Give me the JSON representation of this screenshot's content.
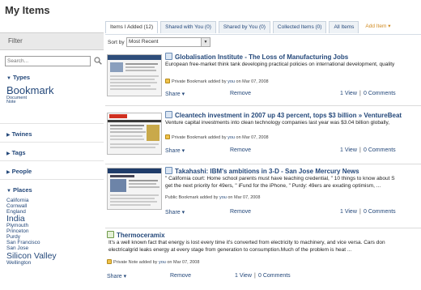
{
  "page": {
    "title": "My Items"
  },
  "tabs": [
    {
      "label": "Items I Added (12)",
      "active": true
    },
    {
      "label": "Shared with You (0)",
      "active": false
    },
    {
      "label": "Shared by You (0)",
      "active": false
    },
    {
      "label": "Collected Items (0)",
      "active": false
    },
    {
      "label": "All Items",
      "active": false
    },
    {
      "label": "Add Item ▾",
      "active": false
    }
  ],
  "sidebar": {
    "filter_label": "Filter",
    "search_placeholder": "Search...",
    "facets": {
      "types": {
        "label": "Types",
        "items": [
          {
            "label": "Bookmark",
            "size": "large"
          },
          {
            "label": "Document",
            "size": "small"
          },
          {
            "label": "Note",
            "size": "small"
          }
        ]
      },
      "twines": {
        "label": "Twines"
      },
      "tags": {
        "label": "Tags"
      },
      "people": {
        "label": "People"
      },
      "places": {
        "label": "Places",
        "items": [
          {
            "label": "California",
            "size": "small"
          },
          {
            "label": "Cornwall",
            "size": "small"
          },
          {
            "label": "England",
            "size": "small"
          },
          {
            "label": "India",
            "size": "medium"
          },
          {
            "label": "Plymouth",
            "size": "small"
          },
          {
            "label": "Princeton",
            "size": "small"
          },
          {
            "label": "Purdy",
            "size": "small"
          },
          {
            "label": "San Francisco",
            "size": "small"
          },
          {
            "label": "San Jose",
            "size": "small"
          },
          {
            "label": "Silicon Valley",
            "size": "medium"
          },
          {
            "label": "Wellington",
            "size": "small"
          }
        ]
      }
    }
  },
  "sort": {
    "label": "Sort by",
    "value": "Most Recent"
  },
  "items": [
    {
      "title": "Globalisation Institute - The Loss of Manufacturing Jobs",
      "description": "European free-market think tank developing practical policies on international development, quality",
      "meta_prefix": "Private Bookmark added by",
      "meta_user": "you",
      "meta_date": "on Mar 07, 2008",
      "share": "Share ▾",
      "remove": "Remove",
      "views": "1 View",
      "comments": "0 Comments"
    },
    {
      "title": "Cleantech investment in 2007 up 43 percent, tops $3 billion » VentureBeat",
      "description": "Venture capital investments into clean technology companies last year was $3.04 billion globally,",
      "meta_prefix": "Private Bookmark added by",
      "meta_user": "you",
      "meta_date": "on Mar 07, 2008",
      "share": "Share ▾",
      "remove": "Remove",
      "views": "1 View",
      "comments": "0 Comments"
    },
    {
      "title": "Takahashi: IBM's ambitions in 3-D - San Jose Mercury News",
      "description": "\" California court: Home school parents must have teaching credential, \" 10 things to know about S",
      "description2": "get the next priority for 49ers, \" iFund for the iPhone, \" Purdy: 49ers are exuding optimism, ...",
      "meta_prefix": "Public Bookmark added by",
      "meta_user": "you",
      "meta_date": "on Mar 07, 2008",
      "share": "Share ▾",
      "remove": "Remove",
      "views": "1 View",
      "comments": "0 Comments"
    },
    {
      "title": "Thermoceramix",
      "description": "It's a well known fact that energy is lost every time it's converted from electricity to machinery, and vice versa. Cars don",
      "description2": "electricalgrid leaks energy at every stage from generation to consumption.Much of the problem is heat ...",
      "meta_prefix": "Private Note added by",
      "meta_user": "you",
      "meta_date": "on Mar 07, 2008",
      "share": "Share ▾",
      "remove": "Remove",
      "views": "1 View",
      "comments": "0 Comments"
    }
  ]
}
